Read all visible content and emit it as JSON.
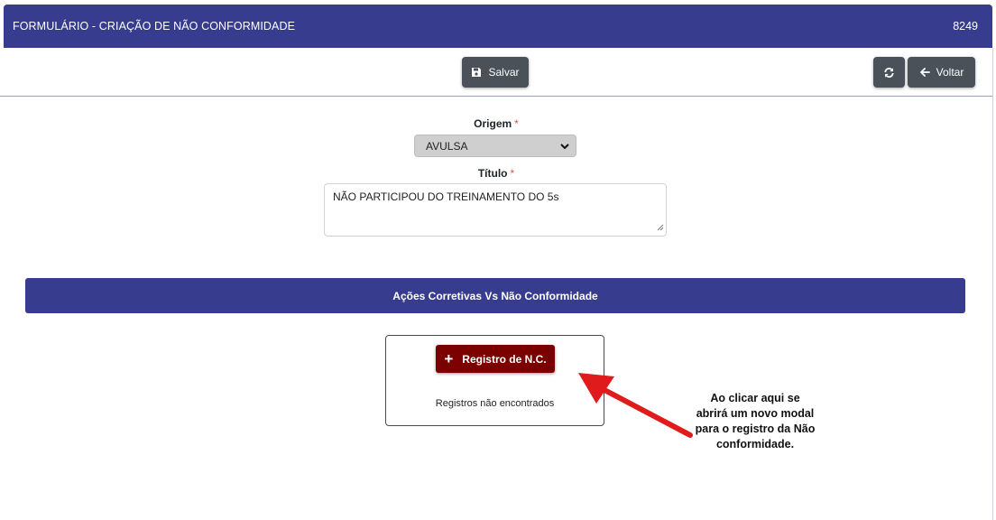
{
  "header": {
    "title": "FORMULÁRIO - CRIAÇÃO DE NÃO CONFORMIDADE",
    "number": "8249"
  },
  "toolbar": {
    "save_label": "Salvar",
    "back_label": "Voltar",
    "save_icon": "floppy-disk-icon",
    "refresh_icon": "refresh-icon",
    "back_icon": "arrow-left-icon"
  },
  "form": {
    "origem_label": "Origem",
    "origem_value": "AVULSA",
    "titulo_label": "Título",
    "titulo_value": "NÃO PARTICIPOU DO TREINAMENTO DO 5s",
    "required_mark": "*"
  },
  "section": {
    "title": "Ações Corretivas Vs Não Conformidade"
  },
  "card": {
    "add_button_label": "Registro de N.C.",
    "add_button_icon": "+",
    "empty_message": "Registros não encontrados"
  },
  "annotation": {
    "text": "Ao clicar aqui se abrirá um novo modal para o registro da Não conformidade."
  },
  "colors": {
    "header_bg": "#383c8e",
    "button_dark": "#4a5158",
    "nc_button": "#7b0000",
    "arrow": "#e01b1b",
    "required": "#d9534f"
  }
}
